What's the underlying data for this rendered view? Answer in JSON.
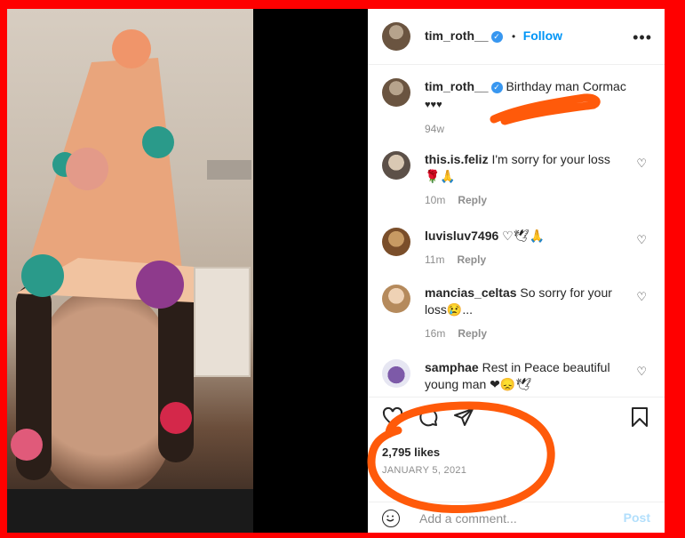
{
  "post": {
    "author": "tim_roth__",
    "separator": "•",
    "follow_label": "Follow",
    "more_label": "•••"
  },
  "caption": {
    "author": "tim_roth__",
    "text": "Birthday man Cormac",
    "hearts": "♥♥♥",
    "age": "94w"
  },
  "comments": [
    {
      "author": "this.is.feliz",
      "text": "I'm sorry for your loss 🌹🙏",
      "age": "10m",
      "reply_label": "Reply"
    },
    {
      "author": "luvisluv7496",
      "text": "♡🕊🙏",
      "age": "11m",
      "reply_label": "Reply"
    },
    {
      "author": "mancias_celtas",
      "text": "So sorry for your loss😢...",
      "age": "16m",
      "reply_label": "Reply"
    },
    {
      "author": "samphae",
      "text": "Rest in Peace beautiful young man ❤😞🕊",
      "age": "",
      "reply_label": ""
    }
  ],
  "likes_text": "2,795 likes",
  "date_text": "JANUARY 5, 2021",
  "add_comment": {
    "placeholder": "Add a comment...",
    "post_label": "Post"
  },
  "annotations": {
    "color": "#ff5a0a"
  },
  "icons": [
    "heart-icon",
    "comment-icon",
    "share-icon",
    "bookmark-icon",
    "emoji-icon",
    "verified-icon"
  ]
}
